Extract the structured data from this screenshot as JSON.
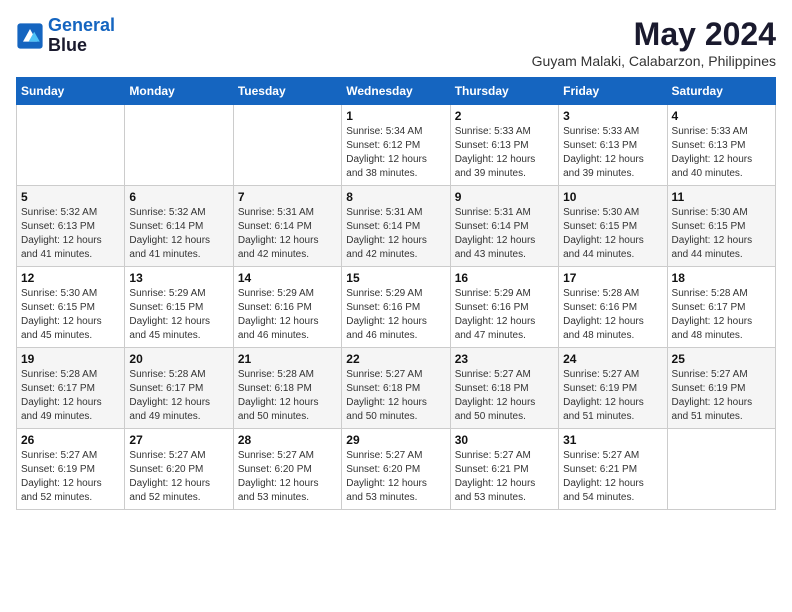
{
  "header": {
    "logo_line1": "General",
    "logo_line2": "Blue",
    "month_title": "May 2024",
    "location": "Guyam Malaki, Calabarzon, Philippines"
  },
  "weekdays": [
    "Sunday",
    "Monday",
    "Tuesday",
    "Wednesday",
    "Thursday",
    "Friday",
    "Saturday"
  ],
  "weeks": [
    [
      {
        "day": "",
        "sunrise": "",
        "sunset": "",
        "daylight": ""
      },
      {
        "day": "",
        "sunrise": "",
        "sunset": "",
        "daylight": ""
      },
      {
        "day": "",
        "sunrise": "",
        "sunset": "",
        "daylight": ""
      },
      {
        "day": "1",
        "sunrise": "Sunrise: 5:34 AM",
        "sunset": "Sunset: 6:12 PM",
        "daylight": "Daylight: 12 hours and 38 minutes."
      },
      {
        "day": "2",
        "sunrise": "Sunrise: 5:33 AM",
        "sunset": "Sunset: 6:13 PM",
        "daylight": "Daylight: 12 hours and 39 minutes."
      },
      {
        "day": "3",
        "sunrise": "Sunrise: 5:33 AM",
        "sunset": "Sunset: 6:13 PM",
        "daylight": "Daylight: 12 hours and 39 minutes."
      },
      {
        "day": "4",
        "sunrise": "Sunrise: 5:33 AM",
        "sunset": "Sunset: 6:13 PM",
        "daylight": "Daylight: 12 hours and 40 minutes."
      }
    ],
    [
      {
        "day": "5",
        "sunrise": "Sunrise: 5:32 AM",
        "sunset": "Sunset: 6:13 PM",
        "daylight": "Daylight: 12 hours and 41 minutes."
      },
      {
        "day": "6",
        "sunrise": "Sunrise: 5:32 AM",
        "sunset": "Sunset: 6:14 PM",
        "daylight": "Daylight: 12 hours and 41 minutes."
      },
      {
        "day": "7",
        "sunrise": "Sunrise: 5:31 AM",
        "sunset": "Sunset: 6:14 PM",
        "daylight": "Daylight: 12 hours and 42 minutes."
      },
      {
        "day": "8",
        "sunrise": "Sunrise: 5:31 AM",
        "sunset": "Sunset: 6:14 PM",
        "daylight": "Daylight: 12 hours and 42 minutes."
      },
      {
        "day": "9",
        "sunrise": "Sunrise: 5:31 AM",
        "sunset": "Sunset: 6:14 PM",
        "daylight": "Daylight: 12 hours and 43 minutes."
      },
      {
        "day": "10",
        "sunrise": "Sunrise: 5:30 AM",
        "sunset": "Sunset: 6:15 PM",
        "daylight": "Daylight: 12 hours and 44 minutes."
      },
      {
        "day": "11",
        "sunrise": "Sunrise: 5:30 AM",
        "sunset": "Sunset: 6:15 PM",
        "daylight": "Daylight: 12 hours and 44 minutes."
      }
    ],
    [
      {
        "day": "12",
        "sunrise": "Sunrise: 5:30 AM",
        "sunset": "Sunset: 6:15 PM",
        "daylight": "Daylight: 12 hours and 45 minutes."
      },
      {
        "day": "13",
        "sunrise": "Sunrise: 5:29 AM",
        "sunset": "Sunset: 6:15 PM",
        "daylight": "Daylight: 12 hours and 45 minutes."
      },
      {
        "day": "14",
        "sunrise": "Sunrise: 5:29 AM",
        "sunset": "Sunset: 6:16 PM",
        "daylight": "Daylight: 12 hours and 46 minutes."
      },
      {
        "day": "15",
        "sunrise": "Sunrise: 5:29 AM",
        "sunset": "Sunset: 6:16 PM",
        "daylight": "Daylight: 12 hours and 46 minutes."
      },
      {
        "day": "16",
        "sunrise": "Sunrise: 5:29 AM",
        "sunset": "Sunset: 6:16 PM",
        "daylight": "Daylight: 12 hours and 47 minutes."
      },
      {
        "day": "17",
        "sunrise": "Sunrise: 5:28 AM",
        "sunset": "Sunset: 6:16 PM",
        "daylight": "Daylight: 12 hours and 48 minutes."
      },
      {
        "day": "18",
        "sunrise": "Sunrise: 5:28 AM",
        "sunset": "Sunset: 6:17 PM",
        "daylight": "Daylight: 12 hours and 48 minutes."
      }
    ],
    [
      {
        "day": "19",
        "sunrise": "Sunrise: 5:28 AM",
        "sunset": "Sunset: 6:17 PM",
        "daylight": "Daylight: 12 hours and 49 minutes."
      },
      {
        "day": "20",
        "sunrise": "Sunrise: 5:28 AM",
        "sunset": "Sunset: 6:17 PM",
        "daylight": "Daylight: 12 hours and 49 minutes."
      },
      {
        "day": "21",
        "sunrise": "Sunrise: 5:28 AM",
        "sunset": "Sunset: 6:18 PM",
        "daylight": "Daylight: 12 hours and 50 minutes."
      },
      {
        "day": "22",
        "sunrise": "Sunrise: 5:27 AM",
        "sunset": "Sunset: 6:18 PM",
        "daylight": "Daylight: 12 hours and 50 minutes."
      },
      {
        "day": "23",
        "sunrise": "Sunrise: 5:27 AM",
        "sunset": "Sunset: 6:18 PM",
        "daylight": "Daylight: 12 hours and 50 minutes."
      },
      {
        "day": "24",
        "sunrise": "Sunrise: 5:27 AM",
        "sunset": "Sunset: 6:19 PM",
        "daylight": "Daylight: 12 hours and 51 minutes."
      },
      {
        "day": "25",
        "sunrise": "Sunrise: 5:27 AM",
        "sunset": "Sunset: 6:19 PM",
        "daylight": "Daylight: 12 hours and 51 minutes."
      }
    ],
    [
      {
        "day": "26",
        "sunrise": "Sunrise: 5:27 AM",
        "sunset": "Sunset: 6:19 PM",
        "daylight": "Daylight: 12 hours and 52 minutes."
      },
      {
        "day": "27",
        "sunrise": "Sunrise: 5:27 AM",
        "sunset": "Sunset: 6:20 PM",
        "daylight": "Daylight: 12 hours and 52 minutes."
      },
      {
        "day": "28",
        "sunrise": "Sunrise: 5:27 AM",
        "sunset": "Sunset: 6:20 PM",
        "daylight": "Daylight: 12 hours and 53 minutes."
      },
      {
        "day": "29",
        "sunrise": "Sunrise: 5:27 AM",
        "sunset": "Sunset: 6:20 PM",
        "daylight": "Daylight: 12 hours and 53 minutes."
      },
      {
        "day": "30",
        "sunrise": "Sunrise: 5:27 AM",
        "sunset": "Sunset: 6:21 PM",
        "daylight": "Daylight: 12 hours and 53 minutes."
      },
      {
        "day": "31",
        "sunrise": "Sunrise: 5:27 AM",
        "sunset": "Sunset: 6:21 PM",
        "daylight": "Daylight: 12 hours and 54 minutes."
      },
      {
        "day": "",
        "sunrise": "",
        "sunset": "",
        "daylight": ""
      }
    ]
  ]
}
